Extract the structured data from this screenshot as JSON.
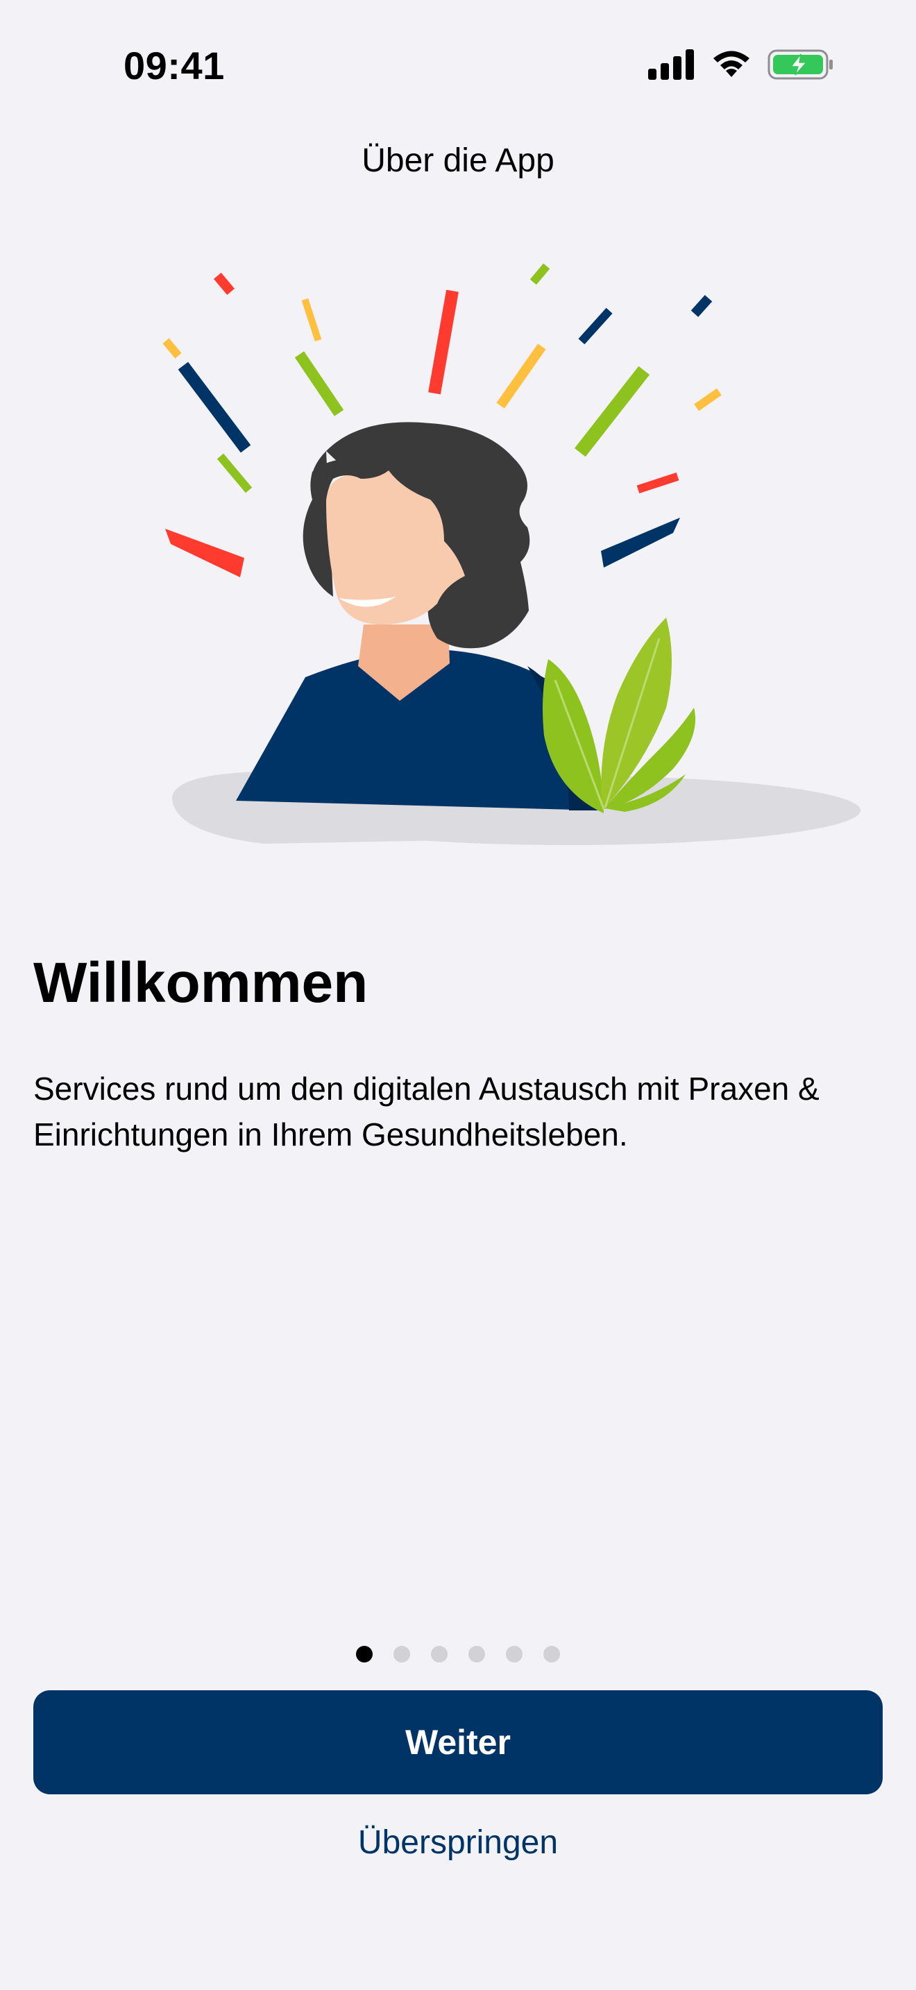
{
  "status_bar": {
    "time": "09:41",
    "icons": [
      "cellular-signal-icon",
      "wifi-icon",
      "battery-charging-icon"
    ],
    "battery_color": "#34C759"
  },
  "nav": {
    "title": "Über die App"
  },
  "onboarding": {
    "headline": "Willkommen",
    "description": "Services rund um den digitalen Austausch mit Praxen & Einrichtungen in Ihrem Gesundheitsleben.",
    "illustration": "welcome-person-illustration",
    "page_count": 6,
    "current_page": 1
  },
  "actions": {
    "primary_label": "Weiter",
    "skip_label": "Überspringen"
  },
  "colors": {
    "background": "#F2F2F7",
    "brand_primary": "#003366",
    "accent_green": "#8DC21F",
    "accent_red": "#FF3B30",
    "accent_yellow": "#FFBF3F"
  }
}
